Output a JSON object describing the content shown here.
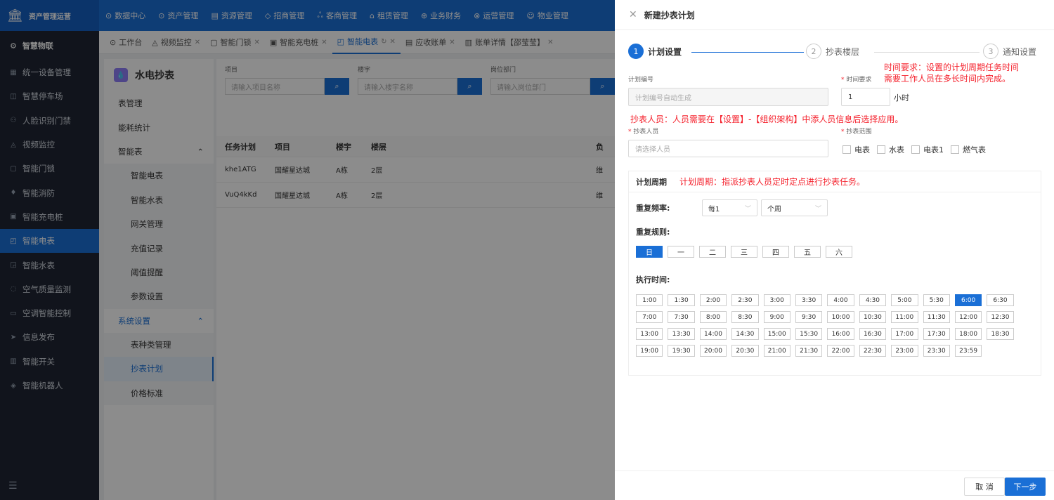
{
  "app": {
    "title": "资产管理运营"
  },
  "topnav": [
    "数据中心",
    "资产管理",
    "资源管理",
    "招商管理",
    "客商管理",
    "租赁管理",
    "业务财务",
    "运营管理",
    "物业管理"
  ],
  "sidebar": {
    "brand": "智慧物联",
    "items": [
      "统一设备管理",
      "智慧停车场",
      "人脸识别门禁",
      "视频监控",
      "智能门锁",
      "智能消防",
      "智能充电桩",
      "智能电表",
      "智能水表",
      "空气质量监测",
      "空调智能控制",
      "信息发布",
      "智能开关",
      "智能机器人"
    ]
  },
  "tabs": [
    "工作台",
    "视频监控",
    "智能门锁",
    "智能充电桩",
    "智能电表",
    "应收账单",
    "账单详情【邵莹莹】"
  ],
  "submenu": {
    "title": "水电抄表",
    "items": [
      {
        "label": "表管理",
        "level": 1
      },
      {
        "label": "能耗统计",
        "level": 1
      },
      {
        "label": "智能表",
        "level": 1,
        "arrow": "⌃"
      },
      {
        "label": "智能电表",
        "level": 2
      },
      {
        "label": "智能水表",
        "level": 2
      },
      {
        "label": "网关管理",
        "level": 2
      },
      {
        "label": "充值记录",
        "level": 2
      },
      {
        "label": "阈值提醒",
        "level": 2
      },
      {
        "label": "参数设置",
        "level": 2
      },
      {
        "label": "系统设置",
        "level": 1,
        "arrow": "⌃",
        "blue": true
      },
      {
        "label": "表种类管理",
        "level": 2
      },
      {
        "label": "抄表计划",
        "level": 2,
        "active": true
      },
      {
        "label": "价格标准",
        "level": 2
      }
    ]
  },
  "filters": [
    {
      "label": "项目",
      "placeholder": "请输入项目名称"
    },
    {
      "label": "楼宇",
      "placeholder": "请输入楼宇名称"
    },
    {
      "label": "岗位部门",
      "placeholder": "请输入岗位部门"
    }
  ],
  "table": {
    "headers": [
      "任务计划",
      "项目",
      "楼宇",
      "楼层",
      "负"
    ],
    "rows": [
      [
        "khe1ATG",
        "国耀星达城",
        "A栋",
        "2层",
        "维"
      ],
      [
        "VuQ4kKd",
        "国耀星达城",
        "A栋",
        "2层",
        "维"
      ]
    ]
  },
  "drawer": {
    "title": "新建抄表计划",
    "steps": [
      {
        "n": "1",
        "label": "计划设置"
      },
      {
        "n": "2",
        "label": "抄表楼层"
      },
      {
        "n": "3",
        "label": "通知设置"
      }
    ],
    "plan_no_label": "计划编号",
    "plan_no_placeholder": "计划编号自动生成",
    "time_req_label": "时间要求",
    "time_req_value": "1",
    "time_unit": "小时",
    "note_time_1": "时间要求：设置的计划周期任务时间",
    "note_time_2": "需要工作人员在多长时间内完成。",
    "note_person": "抄表人员：人员需要在【设置】-【组织架构】中添人员信息后选择应用。",
    "person_label": "抄表人员",
    "person_placeholder": "请选择人员",
    "scope_label": "抄表范围",
    "scope_options": [
      "电表",
      "水表",
      "电表1",
      "燃气表"
    ],
    "cycle_title": "计划周期",
    "cycle_note": "计划周期：指派抄表人员定时定点进行抄表任务。",
    "freq_label": "重复频率:",
    "freq_value": "每1",
    "freq_unit": "个周",
    "rule_label": "重复规则:",
    "days": [
      "日",
      "一",
      "二",
      "三",
      "四",
      "五",
      "六"
    ],
    "day_selected": "日",
    "exec_label": "执行时间:",
    "times": [
      "1:00",
      "1:30",
      "2:00",
      "2:30",
      "3:00",
      "3:30",
      "4:00",
      "4:30",
      "5:00",
      "5:30",
      "6:00",
      "6:30",
      "7:00",
      "7:30",
      "8:00",
      "8:30",
      "9:00",
      "9:30",
      "10:00",
      "10:30",
      "11:00",
      "11:30",
      "12:00",
      "12:30",
      "13:00",
      "13:30",
      "14:00",
      "14:30",
      "15:00",
      "15:30",
      "16:00",
      "16:30",
      "17:00",
      "17:30",
      "18:00",
      "18:30",
      "19:00",
      "19:30",
      "20:00",
      "20:30",
      "21:00",
      "21:30",
      "22:00",
      "22:30",
      "23:00",
      "23:30",
      "23:59"
    ],
    "time_selected": "6:00",
    "cancel": "取 消",
    "next": "下一步"
  }
}
